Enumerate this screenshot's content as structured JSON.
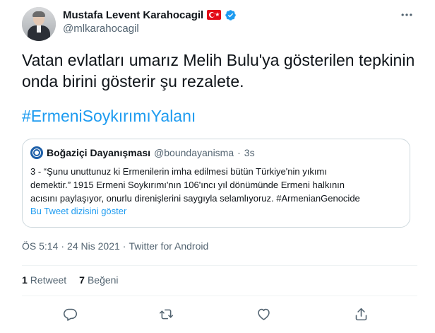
{
  "author": {
    "display_name": "Mustafa Levent Karahocagil",
    "handle": "@mlkarahocagil"
  },
  "tweet": {
    "text": "Vatan evlatları umarız Melih Bulu'ya gösterilen tepkinin\nonda birini gösterir şu rezalete.",
    "hashtag": "#ErmeniSoykırımıYalanı"
  },
  "quoted_tweet": {
    "name": "Boğaziçi Dayanışması",
    "handle": "@boundayanisma",
    "separator": "·",
    "time": "3s",
    "text": "3 - “Şunu unuttunuz ki Ermenilerin imha edilmesi bütün Türkiye'nin yıkımı\ndemektir.” 1915 Ermeni Soykırımı'nın 106'ıncı yıl dönümünde Ermeni halkının\nacısını paylaşıyor, onurlu direnişlerini saygıyla selamlıyoruz. #ArmenianGenocide",
    "thread_link": "Bu Tweet dizisini göster"
  },
  "meta": {
    "time": "ÖS 5:14",
    "sep1": "·",
    "date": "24 Nis 2021",
    "sep2": "·",
    "source": "Twitter for Android"
  },
  "stats": {
    "retweets_count": "1",
    "retweets_label": "Retweet",
    "likes_count": "7",
    "likes_label": "Beğeni"
  },
  "icons": {
    "verified": "verified-badge-icon",
    "more": "more-dots-icon",
    "reply": "reply-icon",
    "retweet": "retweet-icon",
    "like": "heart-icon",
    "share": "share-icon"
  },
  "colors": {
    "link": "#1d9bf0",
    "secondary_text": "#536471",
    "border": "#cfd9de"
  }
}
